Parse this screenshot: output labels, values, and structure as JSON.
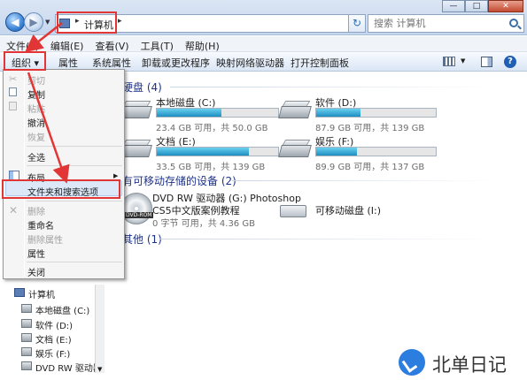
{
  "window": {
    "address_path": "计算机",
    "search_placeholder": "搜索 计算机",
    "controls": [
      "—",
      "□",
      "✕"
    ]
  },
  "menubar": {
    "items": [
      "文件(F)",
      "编辑(E)",
      "查看(V)",
      "工具(T)",
      "帮助(H)"
    ]
  },
  "toolbar": {
    "organize": "组织 ▾",
    "items": [
      "属性",
      "系统属性",
      "卸载或更改程序",
      "映射网络驱动器",
      "打开控制面板"
    ]
  },
  "content": {
    "hard_disks_title": "硬盘 (4)",
    "drives": [
      {
        "name": "本地磁盘 (C:)",
        "size": "23.4 GB 可用，共 50.0 GB",
        "used_fraction": 0.53
      },
      {
        "name": "软件 (D:)",
        "size": "87.9 GB 可用，共 139 GB",
        "used_fraction": 0.37
      },
      {
        "name": "文档 (E:)",
        "size": "33.5 GB 可用，共 139 GB",
        "used_fraction": 0.76
      },
      {
        "name": "娱乐 (F:)",
        "size": "89.9 GB 可用，共 137 GB",
        "used_fraction": 0.34
      }
    ],
    "removable_title": "有可移动存储的设备 (2)",
    "dvd": {
      "name": "DVD RW 驱动器 (G:) Photoshop",
      "name2": "CS5中文版案例教程",
      "size": "0 字节 可用，共 4.36 GB",
      "label": "DVD-ROM"
    },
    "usb": {
      "name": "可移动磁盘 (I:)"
    },
    "other_title": "其他 (1)"
  },
  "menu": {
    "items": [
      {
        "label": "剪切",
        "enabled": false
      },
      {
        "label": "复制",
        "enabled": true
      },
      {
        "label": "粘贴",
        "enabled": false
      },
      {
        "label": "撤消",
        "enabled": true
      },
      {
        "label": "恢复",
        "enabled": false
      },
      {
        "label": "全选",
        "enabled": true
      },
      {
        "label": "布局",
        "enabled": true
      },
      {
        "label": "文件夹和搜索选项",
        "enabled": true
      },
      {
        "label": "删除",
        "enabled": false
      },
      {
        "label": "重命名",
        "enabled": true
      },
      {
        "label": "删除属性",
        "enabled": false
      },
      {
        "label": "属性",
        "enabled": true
      },
      {
        "label": "关闭",
        "enabled": true
      }
    ]
  },
  "navpane": {
    "items": [
      "计算机",
      "本地磁盘 (C:)",
      "软件 (D:)",
      "文档 (E:)",
      "娱乐 (F:)",
      "DVD RW 驱动器"
    ]
  },
  "watermark": {
    "text": "北单日记"
  },
  "colors": {
    "annotation_red": "#e23636",
    "bar_fill": "#26a0d2",
    "section_blue": "#1e3287"
  }
}
